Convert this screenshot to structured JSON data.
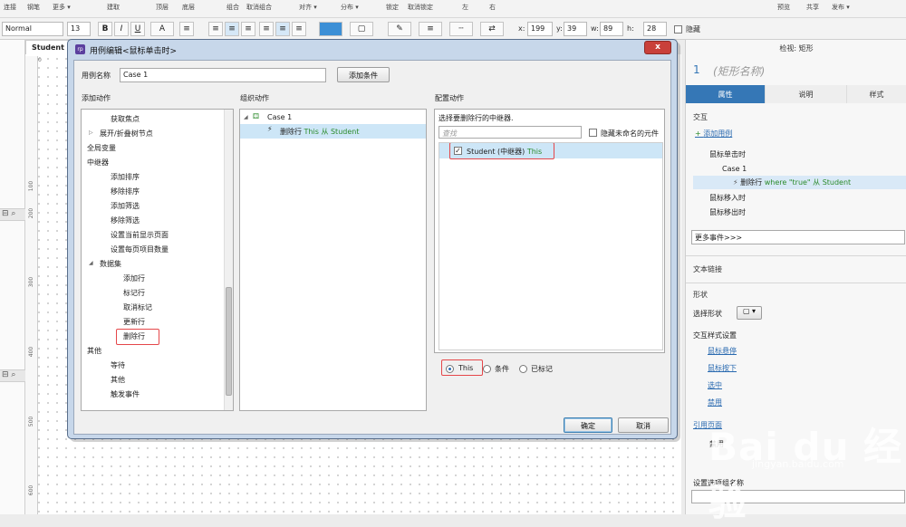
{
  "toolbar_top": {
    "items": [
      "连接",
      "钢笔",
      "更多 ▾",
      "建取",
      "顶层",
      "底层",
      "组合",
      "取消组合",
      "对齐 ▾",
      "分布 ▾",
      "锁定",
      "取消锁定",
      "左",
      "右",
      "预览",
      "共享",
      "发布 ▾"
    ]
  },
  "format_toolbar": {
    "style": "Normal",
    "font_size": "13",
    "bold": "B",
    "italic": "I",
    "underline": "U",
    "text_color": "A",
    "x_label": "x:",
    "x_value": "199",
    "y_label": "y:",
    "y_value": "39",
    "w_label": "w:",
    "w_value": "89",
    "h_label": "h:",
    "h_value": "28",
    "hidden_label": "隐藏"
  },
  "page": {
    "tab": "Student (",
    "ruler_marks": [
      "100",
      "200",
      "300",
      "400",
      "500",
      "600"
    ],
    "ruler_top_zero": "0"
  },
  "dialog": {
    "title": "用例编辑<鼠标单击时>",
    "close": "x",
    "case_name_label": "用例名称",
    "case_name_value": "Case 1",
    "add_condition": "添加条件",
    "add_action_header": "添加动作",
    "organize_header": "组织动作",
    "configure_header": "配置动作",
    "actions_tree": [
      {
        "label": "获取焦点",
        "arrow": ""
      },
      {
        "label": "展开/折叠树节点",
        "arrow": "▷"
      },
      {
        "label": "全局变量",
        "arrow": "▷"
      },
      {
        "label": "中继器",
        "arrow": "◢"
      },
      {
        "label": "添加排序",
        "arrow": ""
      },
      {
        "label": "移除排序",
        "arrow": ""
      },
      {
        "label": "添加筛选",
        "arrow": ""
      },
      {
        "label": "移除筛选",
        "arrow": ""
      },
      {
        "label": "设置当前显示页面",
        "arrow": ""
      },
      {
        "label": "设置每页项目数量",
        "arrow": ""
      },
      {
        "label": "数据集",
        "arrow": "◢"
      },
      {
        "label": "添加行",
        "arrow": ""
      },
      {
        "label": "标记行",
        "arrow": ""
      },
      {
        "label": "取消标记",
        "arrow": ""
      },
      {
        "label": "更新行",
        "arrow": ""
      },
      {
        "label": "删除行",
        "arrow": ""
      },
      {
        "label": "其他",
        "arrow": "◢"
      },
      {
        "label": "等待",
        "arrow": ""
      },
      {
        "label": "其他",
        "arrow": ""
      },
      {
        "label": "触发事件",
        "arrow": ""
      }
    ],
    "organize": {
      "case": "Case 1",
      "action_prefix": "删除行",
      "action_suffix": "This 从 Student"
    },
    "configure": {
      "prompt": "选择要删除行的中继器.",
      "search_placeholder": "查找",
      "hide_unnamed": "隐藏未命名的元件",
      "repeater_item": "Student (中继器)",
      "repeater_this": "This",
      "radio_this": "This",
      "radio_condition": "条件",
      "radio_marked": "已标记"
    },
    "ok": "确定",
    "cancel": "取消"
  },
  "right_panel": {
    "title": "检视: 矩形",
    "number": "1",
    "shape_name": "(矩形名称)",
    "tabs": [
      "属性",
      "说明",
      "样式"
    ],
    "interaction": "交互",
    "add_case": "添加用例",
    "events": [
      {
        "label": "鼠标单击时"
      },
      {
        "label": "Case 1"
      },
      {
        "label_prefix": "删除行",
        "label_suffix": "where \"true\" 从 Student"
      },
      {
        "label": "鼠标移入时"
      },
      {
        "label": "鼠标移出时"
      }
    ],
    "more_events": "更多事件>>>",
    "text_link": "文本链接",
    "shape_section": "形状",
    "select_shape": "选择形状",
    "interaction_styles": "交互样式设置",
    "styles": [
      "鼠标悬停",
      "鼠标按下",
      "选中",
      "禁用"
    ],
    "reference_page": "引用页面",
    "disabled": "禁用",
    "selected_group": "设置选项组名称"
  },
  "watermark": {
    "text": "Bai du 经验",
    "url": "jingyan.baidu.com"
  },
  "colors": {
    "accent": "#3577b6",
    "highlight": "#e5474a",
    "dialog_frame": "#c7d7ea",
    "green_text": "#2a8a2a"
  }
}
